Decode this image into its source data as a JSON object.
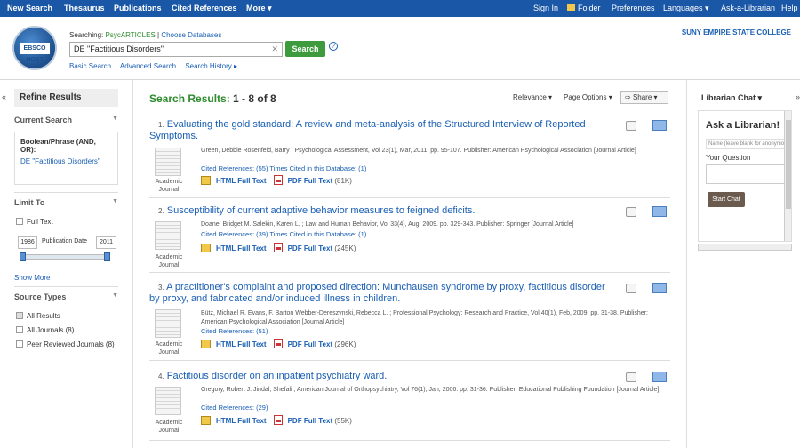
{
  "topnav": {
    "left": [
      "New Search",
      "Thesaurus",
      "Publications",
      "Cited References",
      "More ▾"
    ],
    "right": [
      "Sign In",
      "Folder",
      "Preferences",
      "Languages ▾",
      "Ask-a-Librarian",
      "Help"
    ]
  },
  "logo": {
    "text": "EBSCO HOST"
  },
  "search": {
    "searching_label": "Searching:",
    "database": "PsycARTICLES",
    "choose_link": "Choose Databases",
    "query": "DE \"Factitious Disorders\"",
    "button": "Search",
    "help": "?",
    "links": [
      "Basic Search",
      "Advanced Search",
      "Search History ▸"
    ]
  },
  "institution": "SUNY EMPIRE STATE COLLEGE",
  "sidebar": {
    "collapse": "«",
    "refine": "Refine Results",
    "current_search": "Current Search",
    "boolean_label": "Boolean/Phrase (AND, OR):",
    "boolean_value": "DE \"Factitious Disorders\"",
    "limit_to": "Limit To",
    "full_text": "Full Text",
    "date_from": "1986",
    "date_label": "Publication Date",
    "date_to": "2011",
    "date_range_fraction": [
      0,
      1
    ],
    "show_more": "Show More",
    "source_types": "Source Types",
    "sources": [
      {
        "label": "All Results",
        "checked": true
      },
      {
        "label": "All Journals (8)",
        "checked": false
      },
      {
        "label": "Peer Reviewed Journals (8)",
        "checked": false
      }
    ]
  },
  "results": {
    "heading": "Search Results:",
    "range": "1 - 8 of 8",
    "relevance": "Relevance ▾",
    "page_options": "Page Options ▾",
    "share": "Share ▾",
    "items": [
      {
        "num": "1.",
        "title": "Evaluating the gold standard: A review and meta-analysis of the Structured Interview of Reported Symptoms.",
        "type": "Academic Journal",
        "meta": "Green, Debbie Rosenfeld, Barry ; Psychological Assessment, Vol 23(1), Mar, 2011. pp. 95-107. Publisher: American Psychological Association [Journal Article]",
        "cited": "Cited References: (55) Times Cited in this Database: (1)",
        "html": "HTML Full Text",
        "pdf": "PDF Full Text",
        "size": "(81K)"
      },
      {
        "num": "2.",
        "title": "Susceptibility of current adaptive behavior measures to feigned deficits.",
        "type": "Academic Journal",
        "meta": "Doane, Bridget M. Salekin, Karen L. ; Law and Human Behavior, Vol 33(4), Aug, 2009. pp. 329-343. Publisher: Springer [Journal Article]",
        "cited": "Cited References: (39) Times Cited in this Database: (1)",
        "html": "HTML Full Text",
        "pdf": "PDF Full Text",
        "size": "(245K)"
      },
      {
        "num": "3.",
        "title": "A practitioner's complaint and proposed direction: Munchausen syndrome by proxy, factitious disorder by proxy, and fabricated and/or induced illness in children.",
        "type": "Academic Journal",
        "meta": "Bütz, Michael R. Evans, F. Barton Webber-Dereszynski, Rebecca L. ; Professional Psychology: Research and Practice, Vol 40(1), Feb, 2009. pp. 31-38. Publisher: American Psychological Association [Journal Article]",
        "cited": "Cited References: (51)",
        "html": "HTML Full Text",
        "pdf": "PDF Full Text",
        "size": "(296K)"
      },
      {
        "num": "4.",
        "title": "Factitious disorder on an inpatient psychiatry ward.",
        "type": "Academic Journal",
        "meta": "Gregory, Robert J. Jindal, Shefali ; American Journal of Orthopsychiatry, Vol 76(1), Jan, 2006. pp. 31-36. Publisher: Educational Publishing Foundation [Journal Article]",
        "cited": "Cited References: (29)",
        "html": "HTML Full Text",
        "pdf": "PDF Full Text",
        "size": "(55K)"
      }
    ]
  },
  "chat": {
    "heading": "Librarian Chat ▾",
    "ask": "Ask a Librarian!",
    "name_placeholder": "Name (leave blank for anonymous)",
    "question": "Your Question",
    "start": "Start Chat",
    "collapse": "»"
  }
}
